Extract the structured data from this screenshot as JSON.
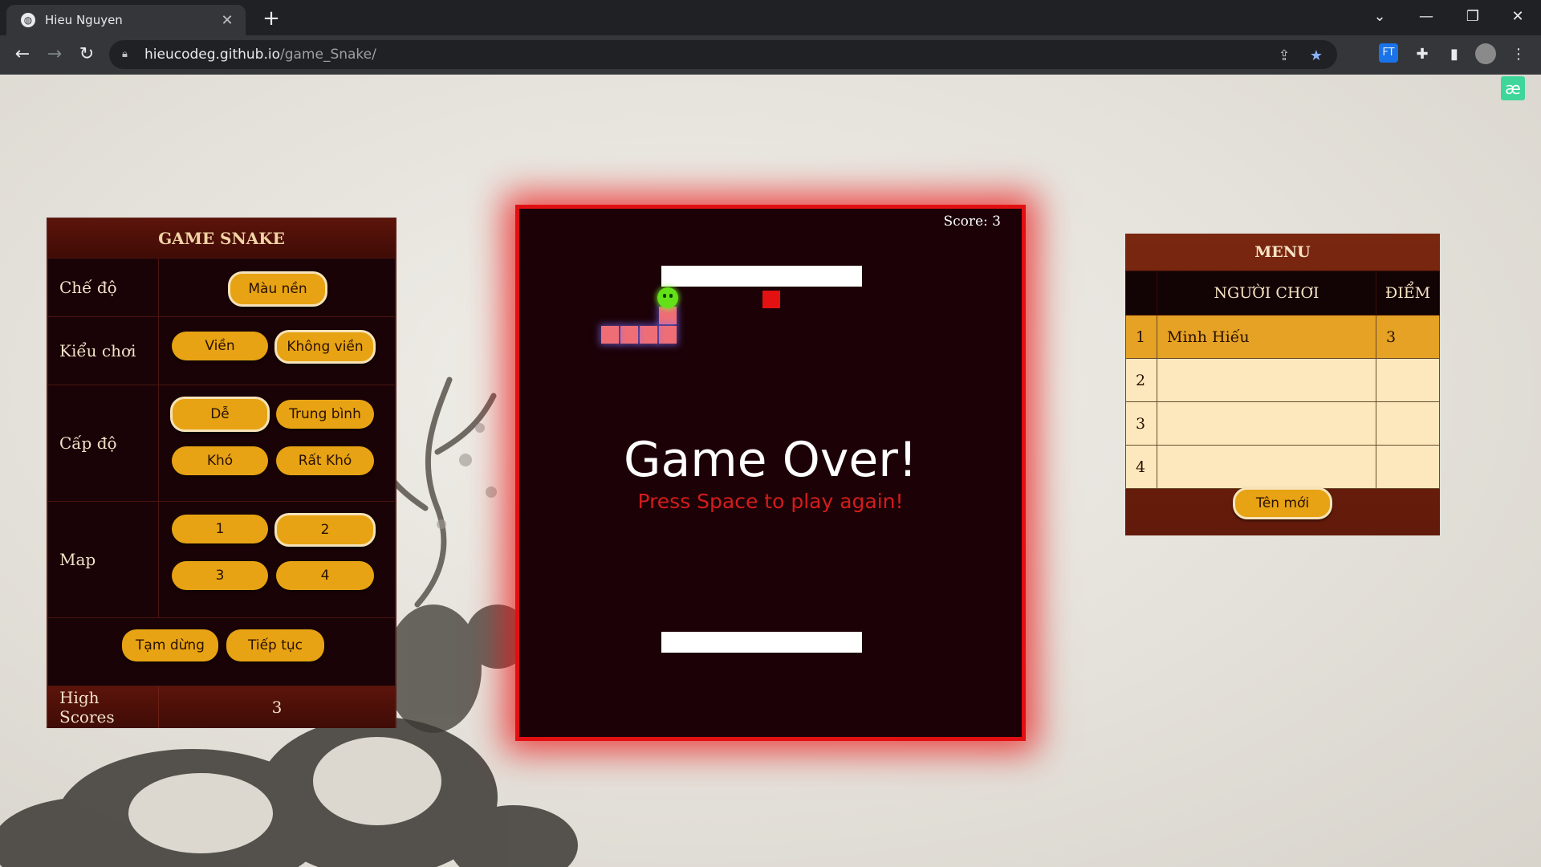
{
  "browser": {
    "tab_title": "Hieu Nguyen",
    "url_host": "hieucodeg.github.io",
    "url_path": "/game_Snake/"
  },
  "left_panel": {
    "title": "GAME SNAKE",
    "rows": {
      "mode": {
        "label": "Chế độ",
        "buttons": [
          "Màu nền"
        ]
      },
      "play_style": {
        "label": "Kiểu chơi",
        "buttons": [
          "Viền",
          "Không viền"
        ],
        "selected": "Không viền"
      },
      "level": {
        "label": "Cấp độ",
        "buttons": [
          "Dễ",
          "Trung bình",
          "Khó",
          "Rất Khó"
        ],
        "selected": "Dễ"
      },
      "map": {
        "label": "Map",
        "buttons": [
          "1",
          "2",
          "3",
          "4"
        ],
        "selected": "2"
      }
    },
    "pause_label": "Tạm dừng",
    "resume_label": "Tiếp tục",
    "high_scores_label": "High Scores",
    "high_scores_value": "3"
  },
  "game": {
    "score_text": "Score: 3",
    "game_over_title": "Game Over!",
    "game_over_subtitle": "Press Space to play again!"
  },
  "menu": {
    "title": "MENU",
    "headers": [
      "NGƯỜI CHƠI",
      "ĐIỂM"
    ],
    "rows": [
      {
        "rank": "1",
        "player": "Minh Hiếu",
        "score": "3"
      },
      {
        "rank": "2",
        "player": "",
        "score": ""
      },
      {
        "rank": "3",
        "player": "",
        "score": ""
      },
      {
        "rank": "4",
        "player": "",
        "score": ""
      }
    ],
    "new_name_label": "Tên mới"
  },
  "colors": {
    "accent": "#e7a313",
    "panel_dark": "#1a0306",
    "game_border": "#e20f12",
    "snake_head": "#63e017",
    "snake_body": "#ef6e76",
    "food": "#e31111"
  }
}
